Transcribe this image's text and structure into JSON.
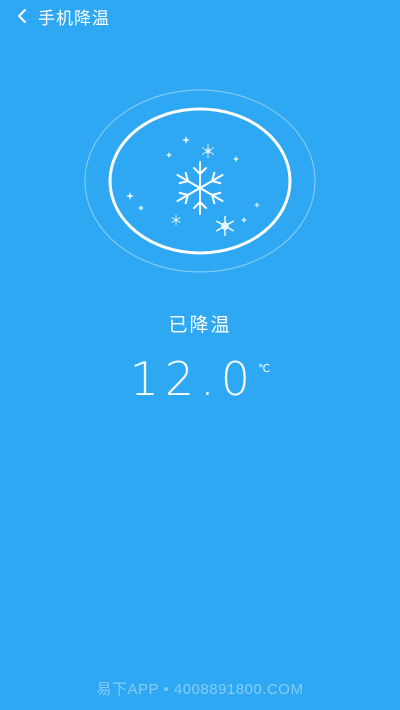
{
  "header": {
    "back_icon": "chevron-left-icon",
    "title": "手机降温"
  },
  "dial": {
    "icon": "snowflake-icon"
  },
  "status": {
    "label": "已降温"
  },
  "temperature": {
    "value": "12.0",
    "unit": "℃"
  },
  "watermark": {
    "text": "易下APP • 4008891800.COM"
  },
  "colors": {
    "background": "#2ea8f3",
    "foreground": "#ffffff"
  }
}
